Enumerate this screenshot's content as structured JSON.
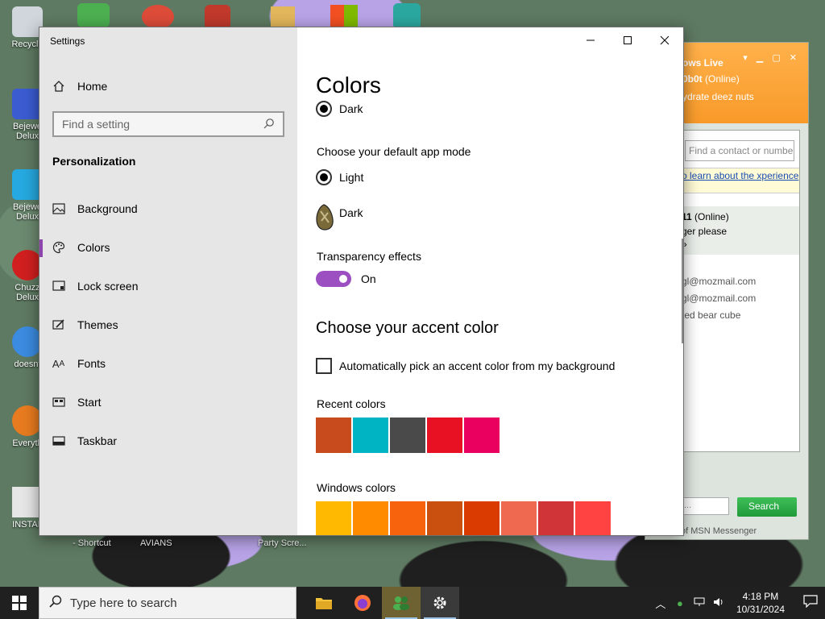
{
  "desktop": {
    "icons": [
      {
        "label": "Recycle",
        "color": "#d0d6dc"
      },
      {
        "label": "Bejewe Delux",
        "color": "#3b5bd1"
      },
      {
        "label": "Bejewe Delux",
        "color": "#26a9e0"
      },
      {
        "label": "Chuzz Delux",
        "color": "#d11f1f"
      },
      {
        "label": "doesnt",
        "color": "#3b8be0"
      },
      {
        "label": "Everyth",
        "color": "#e87b1f"
      },
      {
        "label": "INSTAL",
        "color": "#e6e6e6"
      }
    ],
    "bottom_labels": [
      "- Shortcut",
      "AVIANS",
      "Party Scre..."
    ]
  },
  "msn": {
    "title": "ows Live",
    "user": "0b0t",
    "status": "(Online)",
    "message": "ydrate deez nuts",
    "search_placeholder": "Find a contact or numbe",
    "tip": "o learn about the xperience",
    "contact_name": "11",
    "contact_status": "(Online)",
    "contact_msg": "ger please",
    "mails": [
      "gl@mozmail.com",
      "gl@mozmail.com",
      "ted bear cube"
    ],
    "search_button": "Search",
    "footer": "of MSN Messenger"
  },
  "settings": {
    "window_title": "Settings",
    "home_label": "Home",
    "search_placeholder": "Find a setting",
    "section": "Personalization",
    "nav": [
      {
        "label": "Background",
        "icon": "picture-icon"
      },
      {
        "label": "Colors",
        "icon": "palette-icon"
      },
      {
        "label": "Lock screen",
        "icon": "lock-screen-icon"
      },
      {
        "label": "Themes",
        "icon": "brush-icon"
      },
      {
        "label": "Fonts",
        "icon": "fonts-icon"
      },
      {
        "label": "Start",
        "icon": "start-icon"
      },
      {
        "label": "Taskbar",
        "icon": "taskbar-icon"
      }
    ],
    "active_nav": "Colors",
    "page_title": "Colors",
    "windows_mode_dark": "Dark",
    "app_mode_heading": "Choose your default app mode",
    "app_mode_light": "Light",
    "app_mode_dark": "Dark",
    "transparency_label": "Transparency effects",
    "transparency_state": "On",
    "accent_heading": "Choose your accent color",
    "auto_pick_label": "Automatically pick an accent color from my background",
    "recent_colors_label": "Recent colors",
    "recent_colors": [
      "#c84b1e",
      "#00b4c3",
      "#4a4a4a",
      "#e81123",
      "#ea005e"
    ],
    "windows_colors_label": "Windows colors",
    "windows_colors": [
      "#ffb900",
      "#ff8c00",
      "#f7630c",
      "#ca5010",
      "#da3b01",
      "#ef6950",
      "#d13438",
      "#ff4343"
    ],
    "accent_color": "#9b4fc0"
  },
  "taskbar": {
    "search_placeholder": "Type here to search",
    "time": "4:18 PM",
    "date": "10/31/2024"
  }
}
